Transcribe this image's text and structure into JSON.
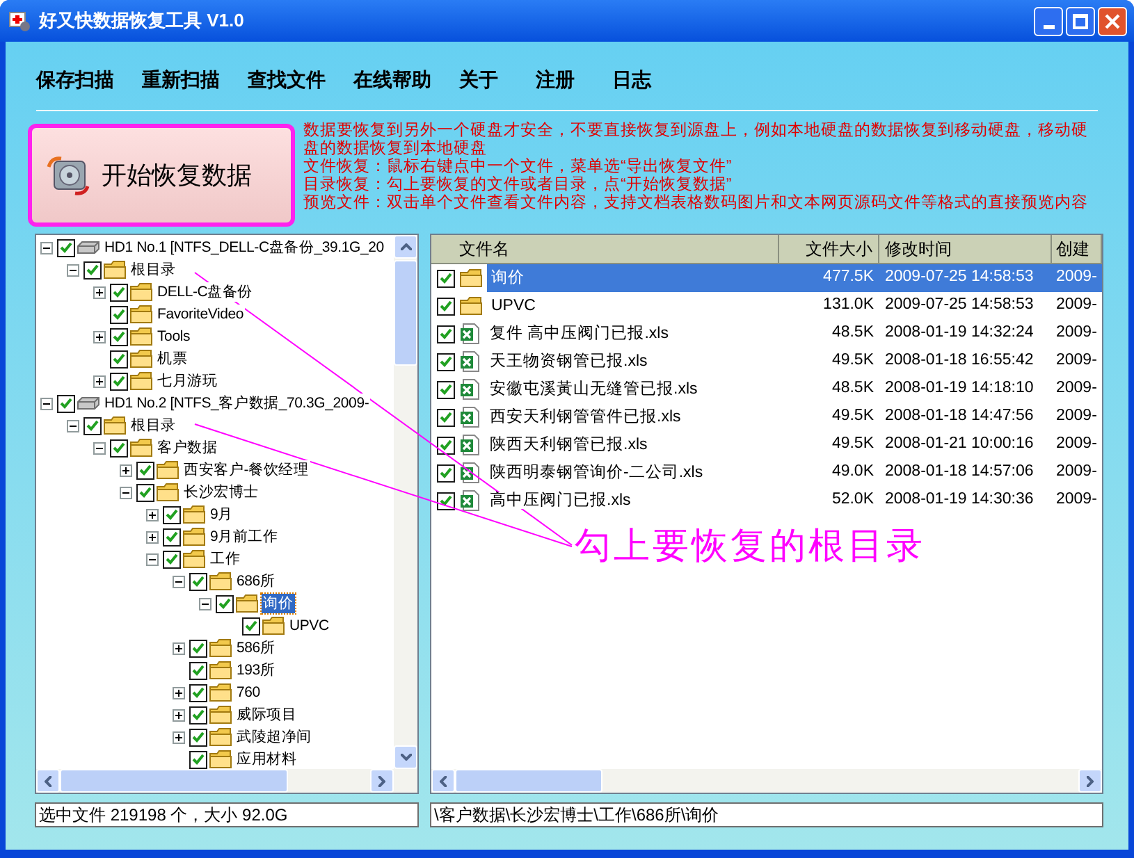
{
  "window": {
    "title": "好又快数据恢复工具 V1.0"
  },
  "menu": [
    {
      "label": "保存扫描"
    },
    {
      "label": "重新扫描"
    },
    {
      "label": "查找文件"
    },
    {
      "label": "在线帮助"
    },
    {
      "label": "关于"
    },
    {
      "label": "注册"
    },
    {
      "label": "日志"
    }
  ],
  "start_button": {
    "label": "开始恢复数据"
  },
  "notes": [
    "数据要恢复到另外一个硬盘才安全，不要直接恢复到源盘上，例如本地硬盘的数据恢复到移动硬盘，移动硬盘的数据恢复到本地硬盘",
    "文件恢复：鼠标右键点中一个文件，菜单选“导出恢复文件”",
    "目录恢复：勾上要恢复的文件或者目录，点“开始恢复数据”",
    "预览文件：双击单个文件查看文件内容，支持文档表格数码图片和文本网页源码文件等格式的直接预览内容"
  ],
  "tree": [
    {
      "kind": "drive",
      "label": "HD1 No.1 [NTFS_DELL-C盘备份_39.1G_20",
      "expandable": true,
      "expanded": true,
      "checked": true,
      "selected": false,
      "children": [
        {
          "kind": "folder",
          "label": "根目录",
          "expandable": true,
          "expanded": true,
          "checked": true,
          "selected": false,
          "children": [
            {
              "kind": "folder",
              "label": "DELL-C盘备份",
              "expandable": true,
              "expanded": false,
              "checked": true,
              "selected": false
            },
            {
              "kind": "folder",
              "label": "FavoriteVideo",
              "expandable": false,
              "checked": true,
              "selected": false
            },
            {
              "kind": "folder",
              "label": "Tools",
              "expandable": true,
              "expanded": false,
              "checked": true,
              "selected": false
            },
            {
              "kind": "folder",
              "label": "机票",
              "expandable": false,
              "checked": true,
              "selected": false
            },
            {
              "kind": "folder",
              "label": "七月游玩",
              "expandable": true,
              "expanded": false,
              "checked": true,
              "selected": false
            }
          ]
        }
      ]
    },
    {
      "kind": "drive",
      "label": "HD1 No.2 [NTFS_客户数据_70.3G_2009-",
      "expandable": true,
      "expanded": true,
      "checked": true,
      "selected": false,
      "children": [
        {
          "kind": "folder",
          "label": "根目录",
          "expandable": true,
          "expanded": true,
          "checked": true,
          "selected": false,
          "children": [
            {
              "kind": "folder",
              "label": "客户数据",
              "expandable": true,
              "expanded": true,
              "checked": true,
              "selected": false,
              "children": [
                {
                  "kind": "folder",
                  "label": "西安客户-餐饮经理",
                  "expandable": true,
                  "expanded": false,
                  "checked": true,
                  "selected": false
                },
                {
                  "kind": "folder",
                  "label": "长沙宏博士",
                  "expandable": true,
                  "expanded": true,
                  "checked": true,
                  "selected": false,
                  "children": [
                    {
                      "kind": "folder",
                      "label": "9月",
                      "expandable": true,
                      "expanded": false,
                      "checked": true,
                      "selected": false
                    },
                    {
                      "kind": "folder",
                      "label": "9月前工作",
                      "expandable": true,
                      "expanded": false,
                      "checked": true,
                      "selected": false
                    },
                    {
                      "kind": "folder",
                      "label": "工作",
                      "expandable": true,
                      "expanded": true,
                      "checked": true,
                      "selected": false,
                      "children": [
                        {
                          "kind": "folder",
                          "label": "686所",
                          "expandable": true,
                          "expanded": true,
                          "checked": true,
                          "selected": false,
                          "children": [
                            {
                              "kind": "folder",
                              "label": "询价",
                              "expandable": true,
                              "expanded": true,
                              "checked": true,
                              "selected": true,
                              "children": [
                                {
                                  "kind": "folder",
                                  "label": "UPVC",
                                  "expandable": false,
                                  "checked": true,
                                  "selected": false
                                }
                              ]
                            }
                          ]
                        },
                        {
                          "kind": "folder",
                          "label": "586所",
                          "expandable": true,
                          "expanded": false,
                          "checked": true,
                          "selected": false
                        },
                        {
                          "kind": "folder",
                          "label": "193所",
                          "expandable": false,
                          "checked": true,
                          "selected": false
                        },
                        {
                          "kind": "folder",
                          "label": "760",
                          "expandable": true,
                          "expanded": false,
                          "checked": true,
                          "selected": false
                        },
                        {
                          "kind": "folder",
                          "label": "威际项目",
                          "expandable": true,
                          "expanded": false,
                          "checked": true,
                          "selected": false
                        },
                        {
                          "kind": "folder",
                          "label": "武陵超净间",
                          "expandable": true,
                          "expanded": false,
                          "checked": true,
                          "selected": false
                        },
                        {
                          "kind": "folder",
                          "label": "应用材料",
                          "expandable": false,
                          "checked": true,
                          "selected": false
                        }
                      ]
                    }
                  ]
                }
              ]
            }
          ]
        }
      ]
    }
  ],
  "file_list": {
    "columns": [
      "文件名",
      "文件大小",
      "修改时间",
      "创建"
    ],
    "rows": [
      {
        "kind": "folder",
        "checked": true,
        "selected": true,
        "name": "询价",
        "size": "477.5K",
        "modified": "2009-07-25 14:58:53",
        "created": "2009-"
      },
      {
        "kind": "folder",
        "checked": true,
        "selected": false,
        "name": "UPVC",
        "size": "131.0K",
        "modified": "2009-07-25 14:58:53",
        "created": "2009-"
      },
      {
        "kind": "xls",
        "checked": true,
        "selected": false,
        "name": "复件 高中压阀门已报.xls",
        "size": "48.5K",
        "modified": "2008-01-19 14:32:24",
        "created": "2009-"
      },
      {
        "kind": "xls",
        "checked": true,
        "selected": false,
        "name": "天王物资钢管已报.xls",
        "size": "49.5K",
        "modified": "2008-01-18 16:55:42",
        "created": "2009-"
      },
      {
        "kind": "xls",
        "checked": true,
        "selected": false,
        "name": "安徽屯溪黃山无缝管已报.xls",
        "size": "48.5K",
        "modified": "2008-01-19 14:18:10",
        "created": "2009-"
      },
      {
        "kind": "xls",
        "checked": true,
        "selected": false,
        "name": "西安天利钢管管件已报.xls",
        "size": "49.5K",
        "modified": "2008-01-18 14:47:56",
        "created": "2009-"
      },
      {
        "kind": "xls",
        "checked": true,
        "selected": false,
        "name": "陕西天利钢管已报.xls",
        "size": "49.5K",
        "modified": "2008-01-21 10:00:16",
        "created": "2009-"
      },
      {
        "kind": "xls",
        "checked": true,
        "selected": false,
        "name": "陕西明泰钢管询价-二公司.xls",
        "size": "49.0K",
        "modified": "2008-01-18 14:57:06",
        "created": "2009-"
      },
      {
        "kind": "xls",
        "checked": true,
        "selected": false,
        "name": "高中压阀门已报.xls",
        "size": "52.0K",
        "modified": "2008-01-19 14:30:36",
        "created": "2009-"
      }
    ]
  },
  "annotation": {
    "text": "勾上要恢复的根目录"
  },
  "status_bar": {
    "selection_info": "选中文件 219198 个，大小 92.0G",
    "path": "\\客户数据\\长沙宏博士\\工作\\686所\\询价"
  }
}
